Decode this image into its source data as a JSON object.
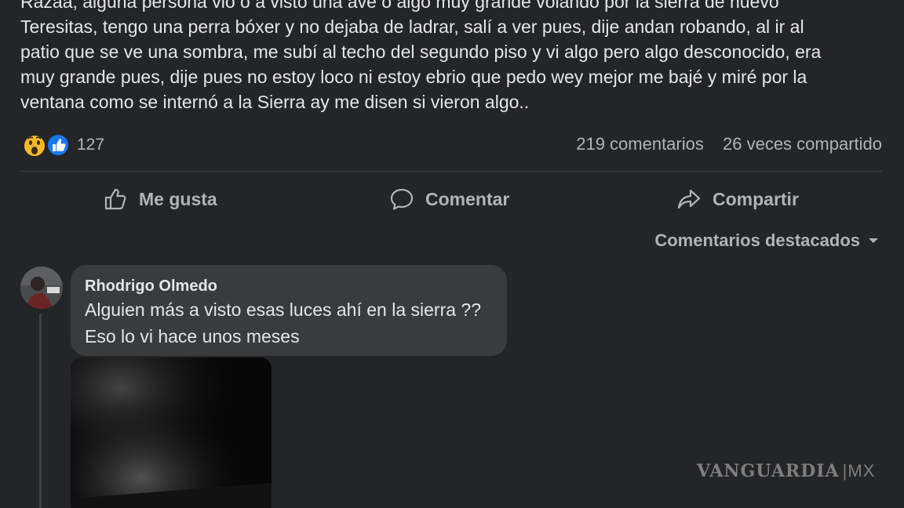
{
  "post": {
    "lines": [
      "Razaa, alguna persona vio o a visto una ave o algo muy grande volando por la sierra de nuevo",
      "Teresitas, tengo una perra bóxer y no dejaba de ladrar, salí a ver pues, dije andan robando, al ir al",
      "patio que se ve una sombra, me subí al techo del segundo piso y vi algo pero algo desconocido, era",
      "muy grande pues, dije pues  no estoy loco ni estoy ebrio que pedo wey mejor me bajé y miré por la",
      "ventana como se internó a la Sierra ay me disen si vieron algo.."
    ]
  },
  "stats": {
    "reaction_icons": [
      "wow-icon",
      "like-icon"
    ],
    "reactions_count": "127",
    "comments": "219 comentarios",
    "shares": "26 veces compartido"
  },
  "actions": {
    "like": "Me gusta",
    "comment": "Comentar",
    "share": "Compartir"
  },
  "comments_filter": "Comentarios destacados",
  "comment": {
    "author": "Rhodrigo Olmedo",
    "lines": [
      "Alguien más a visto esas luces ahí en la sierra ??",
      "Eso lo vi hace unos meses"
    ]
  },
  "watermark": {
    "brand": "VANGUARDIA",
    "suffix": "MX"
  },
  "colors": {
    "background": "#242526",
    "comment_bubble": "#3a3b3c",
    "primary_text": "#e4e6eb",
    "secondary_text": "#b0b3b8",
    "like_blue": "#1877f2",
    "wow_yellow": "#f7b928"
  }
}
